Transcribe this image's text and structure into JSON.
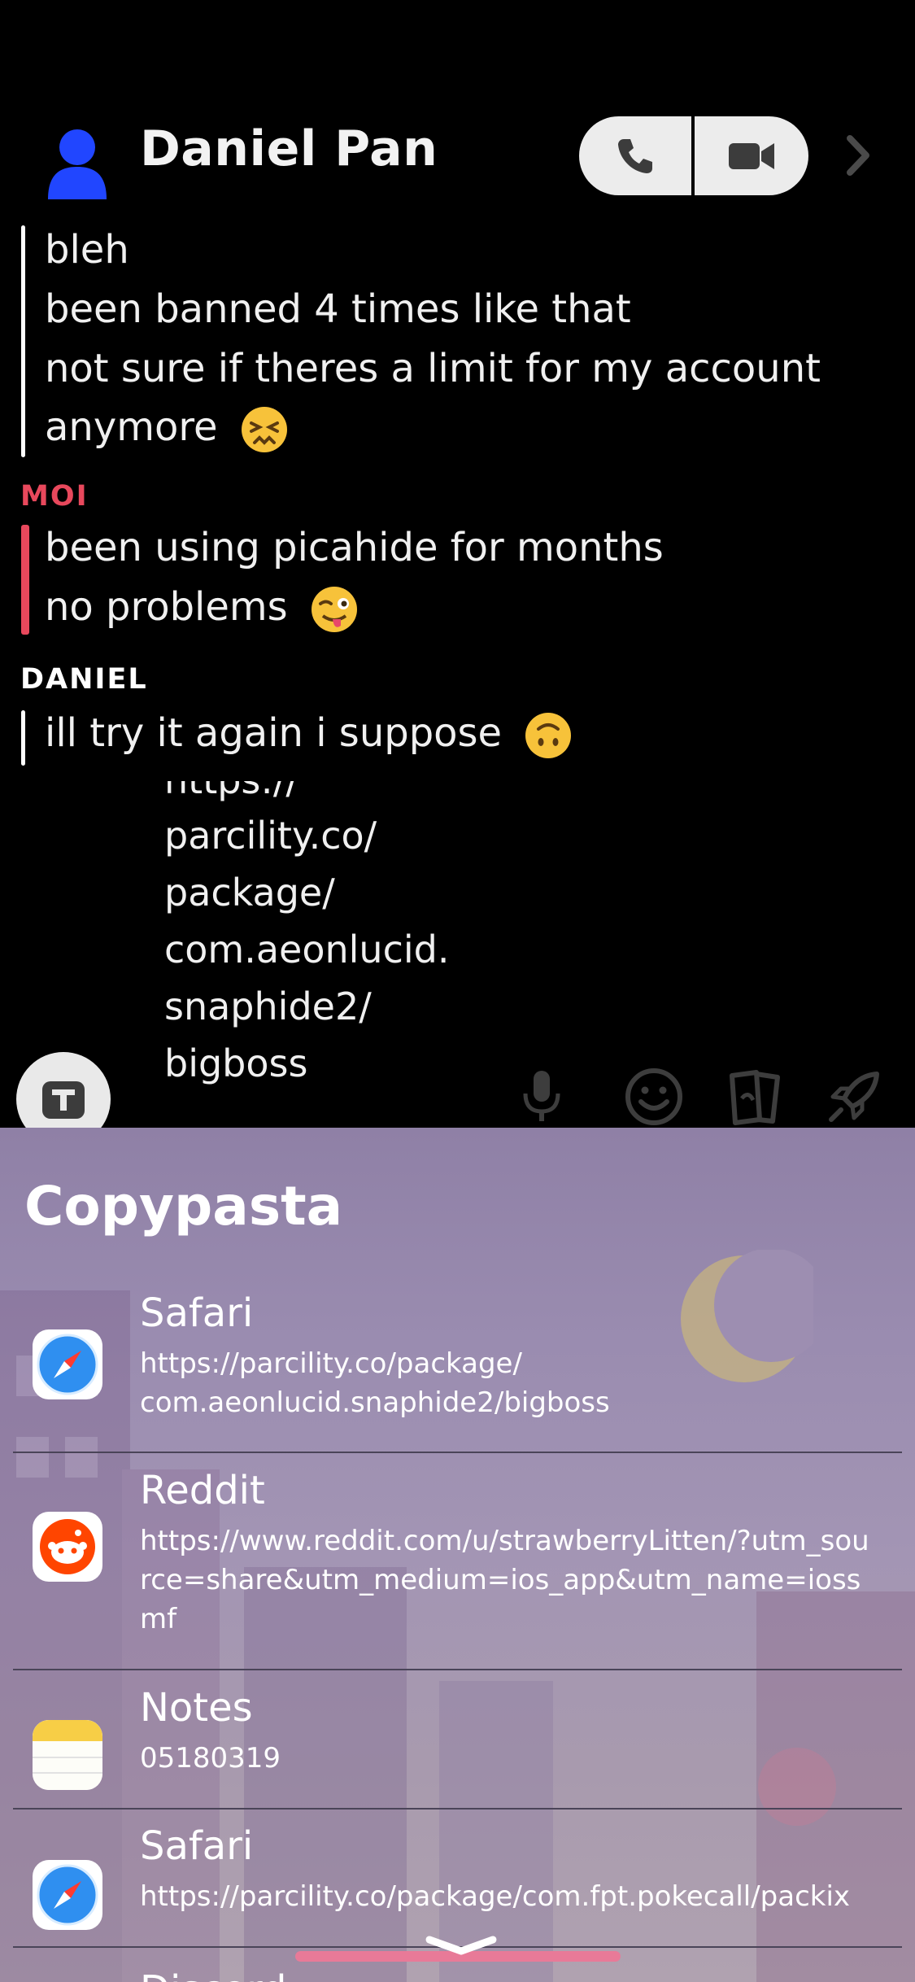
{
  "header": {
    "contact_name": "Daniel Pan",
    "icons": [
      "avatar-icon",
      "phone-icon",
      "video-camera-icon",
      "chevron-right-icon"
    ]
  },
  "chat": {
    "block1": {
      "lines": [
        "bleh",
        "been banned 4 times like that",
        "not sure if theres a limit for my account",
        "anymore"
      ],
      "emoji": "confounded-face-emoji",
      "bar_color": "#ffffff"
    },
    "block2": {
      "sender": "MOI",
      "sender_color": "#e8485c",
      "lines": [
        "been using picahide for months",
        "no problems"
      ],
      "emoji": "winking-face-tongue-emoji",
      "bar_color": "#e8485c"
    },
    "block3": {
      "sender": "DANIEL",
      "sender_color": "#ffffff",
      "lines": [
        "ill try it again i suppose"
      ],
      "emoji": "upside-down-face-emoji",
      "bar_color": "#ffffff"
    }
  },
  "compose": {
    "link_lines": [
      "https://",
      "parcility.co/",
      "package/",
      "com.aeonlucid.",
      "snaphide2/",
      "bigboss"
    ],
    "tools": [
      "text-tool-icon",
      "microphone-icon",
      "smiley-icon",
      "stickers-icon",
      "rocket-icon"
    ]
  },
  "copypasta": {
    "title": "Copypasta",
    "items": [
      {
        "app": "Safari",
        "text": "https://parcility.co/package/\ncom.aeonlucid.snaphide2/bigboss",
        "icon": "safari-icon"
      },
      {
        "app": "Reddit",
        "text": "https://www.reddit.com/u/strawberryLitten/?utm_source=share&utm_medium=ios_app&utm_name=iossmf",
        "icon": "reddit-icon"
      },
      {
        "app": "Notes",
        "text": "05180319",
        "icon": "notes-icon"
      },
      {
        "app": "Safari",
        "text": "https://parcility.co/package/com.fpt.pokecall/packix",
        "icon": "safari-icon"
      }
    ],
    "partial_next": "Discord",
    "accent": "#e87a98"
  }
}
